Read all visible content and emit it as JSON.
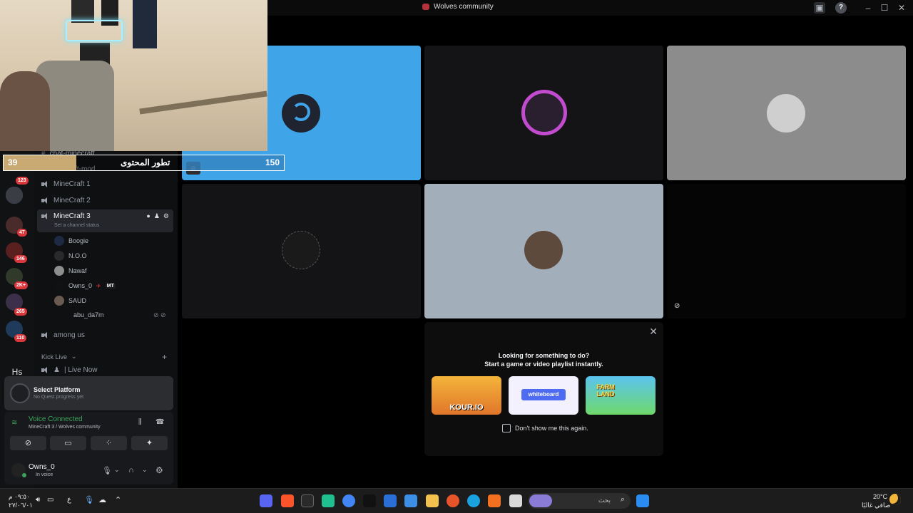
{
  "window": {
    "title": "Wolves community"
  },
  "rail": {
    "badges": [
      "123",
      "47",
      "146",
      "2K+",
      "265",
      "110"
    ],
    "server_initials": "Hs"
  },
  "sidebar": {
    "channels_top": [
      "chat-minecraft",
      "minecraft-mod"
    ],
    "voice_channels": [
      {
        "name": "MineCraft 1"
      },
      {
        "name": "MineCraft 2"
      },
      {
        "name": "MineCraft 3",
        "status": "Set a channel status"
      }
    ],
    "members": [
      {
        "name": "Boogie"
      },
      {
        "name": "N.O.O"
      },
      {
        "name": "Nawaf"
      },
      {
        "name": "Owns_0",
        "tag": "MT"
      },
      {
        "name": "SAUD"
      },
      {
        "name": "abu_da7m"
      }
    ],
    "other_channels": [
      {
        "name": "among us"
      }
    ],
    "category": "Kick Live",
    "live_channel": "| Live Now"
  },
  "platform": {
    "title": "Select Platform",
    "subtitle": "No Quest progress yet"
  },
  "voice": {
    "status": "Voice Connected",
    "location": "MineCraft 3 / Wolves community"
  },
  "user": {
    "name": "Owns_0",
    "status": "In voice"
  },
  "overlay": {
    "left_value": "39",
    "label": "تطور المحتوى",
    "right_value": "150",
    "progress_fraction": 0.26
  },
  "activity": {
    "heading": "Looking for something to do?",
    "subheading": "Start a game or video playlist instantly.",
    "cards": [
      "KOUR.IO",
      "whiteboard",
      "FARM LAND"
    ],
    "checkbox_label": "Don't show me this again."
  },
  "taskbar": {
    "time": "٠٩:٥٠ م",
    "date": "٢٧/٠٦/٠١",
    "lang": "ع",
    "search_placeholder": "بحث",
    "weather_temp": "20°C",
    "weather_desc": "صافي غالبًا"
  },
  "colors": {
    "tile_blue": "#3fa4e8",
    "tile_grey": "#8c8c8c",
    "tile_lightblue": "#a2aeba",
    "voice_green": "#3ba55d",
    "badge_red": "#da373c"
  }
}
